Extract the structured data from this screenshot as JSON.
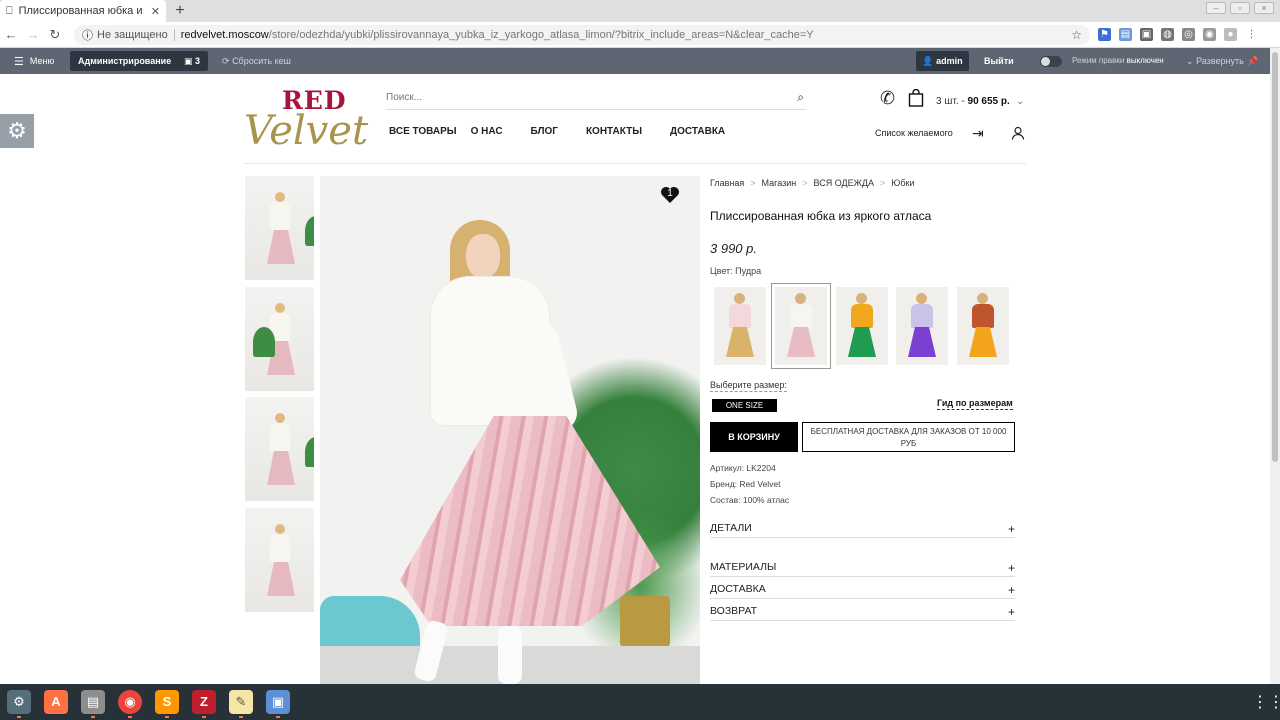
{
  "browser": {
    "tab_title": "Плиссированная юбка и",
    "tab_close": "✕",
    "new_tab": "+",
    "security": "Не защищено",
    "url_host": "redvelvet.moscow",
    "url_path": "/store/odezhda/yubki/plissirovannaya_yubka_iz_yarkogo_atlasa_limon/?bitrix_include_areas=N&clear_cache=Y"
  },
  "admin_panel": {
    "menu": "Меню",
    "administration": "Администрирование",
    "notifications": "3",
    "reset_cache": "Сбросить кеш",
    "user": "admin",
    "logout": "Выйти",
    "edit_mode_label": "Режим правки",
    "edit_mode_state": "выключен",
    "expand": "Развернуть"
  },
  "header": {
    "logo_top": "RED",
    "logo_bottom": "Velvet",
    "search_placeholder": "Поиск...",
    "cart_count": "3 шт. -",
    "cart_total": "90 655 р.",
    "wishlist": "Список желаемого",
    "nav": [
      "ВСЕ ТОВАРЫ",
      "О НАС",
      "БЛОГ",
      "КОНТАКТЫ",
      "ДОСТАВКА"
    ]
  },
  "gallery": {
    "favorite_count": "1"
  },
  "product": {
    "breadcrumb": [
      "Главная",
      "Магазин",
      "ВСЯ ОДЕЖДА",
      "Юбки"
    ],
    "breadcrumb_sep": ">",
    "title": "Плиссированная юбка из яркого атласа",
    "price": "3 990 р.",
    "color_label": "Цвет: Пудра",
    "size_label": "Выберите размер:",
    "size_value": "ONE SIZE",
    "size_guide": "Гид по размерам",
    "add_to_cart": "В КОРЗИНУ",
    "delivery_note": "БЕСПЛАТНАЯ ДОСТАВКА ДЛЯ ЗАКАЗОВ ОТ 10 000 РУБ",
    "sku": "Артикул: LK2204",
    "brand": "Бренд: Red Velvet",
    "composition": "Состав: 100% атлас",
    "accordions": [
      "ДЕТАЛИ",
      "МАТЕРИАЛЫ",
      "ДОСТАВКА",
      "ВОЗВРАТ"
    ],
    "accordion_icon": "+"
  },
  "colors": {
    "variants": [
      {
        "top": "#f3d9dc",
        "skirt": "#d9b36a"
      },
      {
        "top": "#f7f5f0",
        "skirt": "#e8bcc3"
      },
      {
        "top": "#f0a81e",
        "skirt": "#1f9b52"
      },
      {
        "top": "#c9c3e8",
        "skirt": "#7b3fd1"
      },
      {
        "top": "#c0542c",
        "skirt": "#f2a51c"
      }
    ]
  }
}
